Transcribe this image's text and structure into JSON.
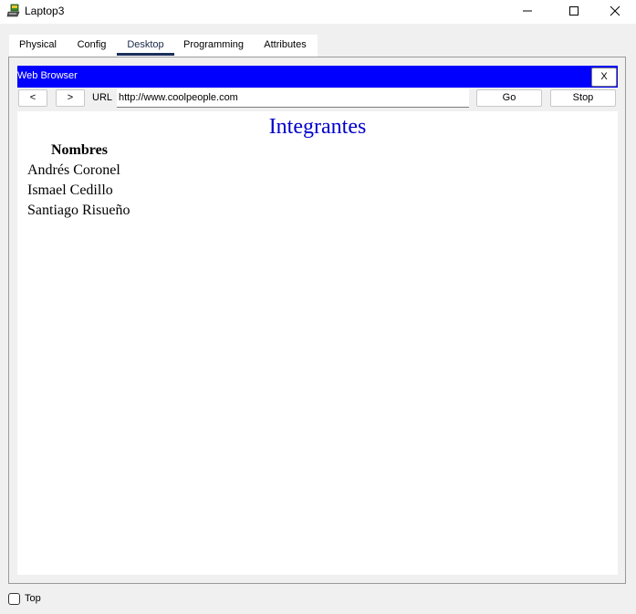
{
  "window": {
    "title": "Laptop3",
    "icon": "laptop-app-icon",
    "controls": [
      "minimize-icon",
      "maximize-icon",
      "close-icon"
    ]
  },
  "tabs": [
    {
      "label": "Physical",
      "active": false
    },
    {
      "label": "Config",
      "active": false
    },
    {
      "label": "Desktop",
      "active": true
    },
    {
      "label": "Programming",
      "active": false
    },
    {
      "label": "Attributes",
      "active": false
    }
  ],
  "browser": {
    "title": "Web Browser",
    "close_label": "X",
    "back_label": "<",
    "forward_label": ">",
    "url_label": "URL",
    "url_value": "http://www.coolpeople.com",
    "go_label": "Go",
    "stop_label": "Stop",
    "header_color": "#0000ff"
  },
  "page": {
    "heading": "Integrantes",
    "heading_color": "#0000cc",
    "column_header": "Nombres",
    "members": [
      "Andrés Coronel",
      "Ismael Cedillo",
      "Santiago Risueño"
    ]
  },
  "footer": {
    "top_label": "Top",
    "top_checked": false
  }
}
